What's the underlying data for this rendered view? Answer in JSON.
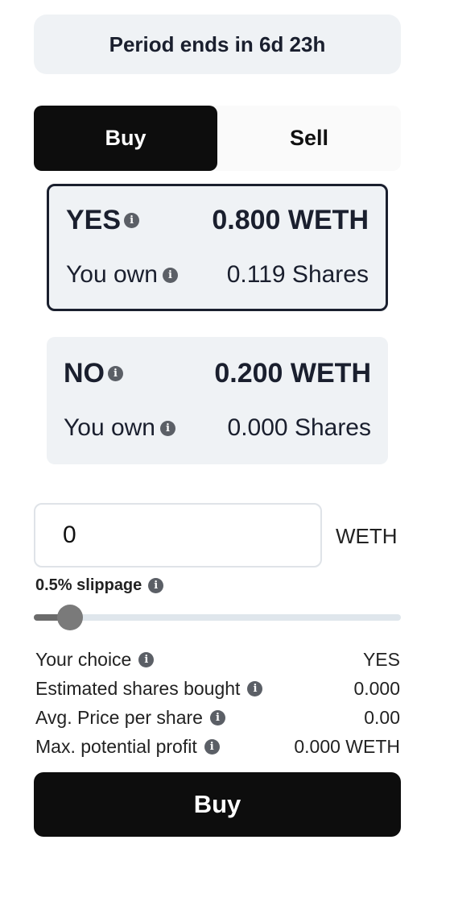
{
  "period": {
    "text": "Period ends in 6d 23h"
  },
  "tabs": {
    "buy": "Buy",
    "sell": "Sell",
    "active": "buy"
  },
  "outcomes": [
    {
      "name": "YES",
      "price": "0.800 WETH",
      "own_label": "You own",
      "own_value": "0.119 Shares",
      "selected": true
    },
    {
      "name": "NO",
      "price": "0.200 WETH",
      "own_label": "You own",
      "own_value": "0.000 Shares",
      "selected": false
    }
  ],
  "amount": {
    "value": "0",
    "currency": "WETH"
  },
  "slippage": {
    "label": "0.5% slippage",
    "level_fraction": 0.06
  },
  "summary": [
    {
      "label": "Your choice",
      "value": "YES"
    },
    {
      "label": "Estimated shares bought",
      "value": "0.000"
    },
    {
      "label": "Avg. Price per share",
      "value": "0.00"
    },
    {
      "label": "Max. potential profit",
      "value": "0.000 WETH"
    }
  ],
  "submit": {
    "label": "Buy"
  },
  "icons": {
    "info": "info-icon"
  },
  "colors": {
    "primary": "#0d0d0d",
    "card_bg": "#eff2f5",
    "selected_border": "#1a1f2e"
  }
}
